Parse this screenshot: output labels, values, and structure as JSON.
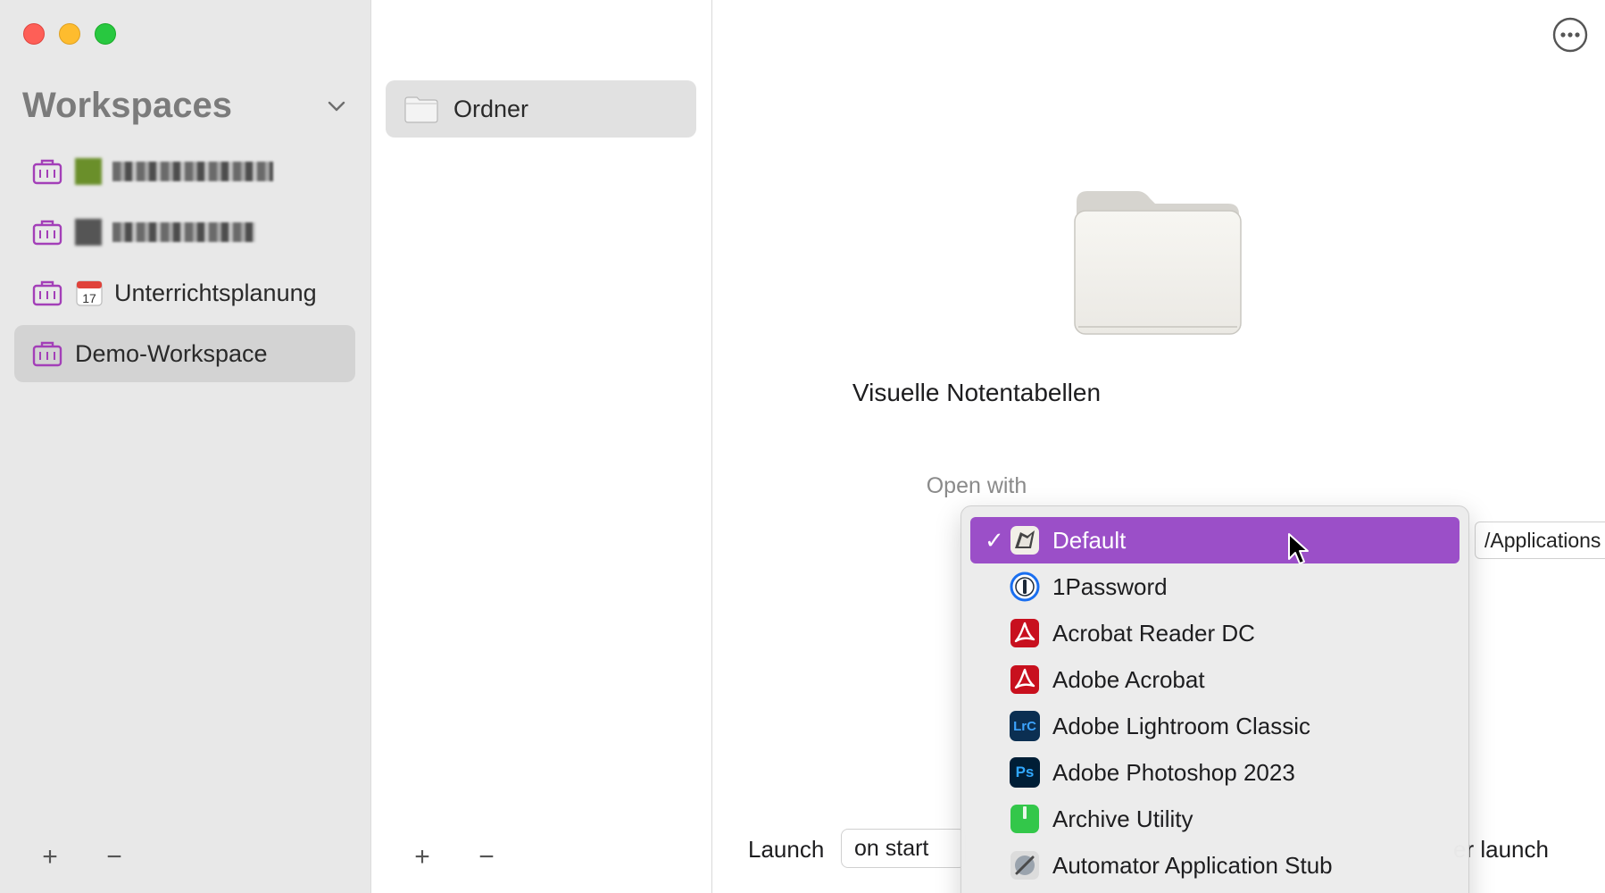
{
  "sidebar": {
    "header": "Workspaces",
    "items": [
      {
        "label": "",
        "blurred": true
      },
      {
        "label": "",
        "blurred": true
      },
      {
        "label": "Unterrichtsplanung",
        "blurred": false
      },
      {
        "label": "Demo-Workspace",
        "blurred": false,
        "selected": true
      }
    ],
    "add_label": "+",
    "remove_label": "−"
  },
  "middle": {
    "folder_label": "Ordner",
    "add_label": "+",
    "remove_label": "−"
  },
  "detail": {
    "title": "Visuelle Notentabellen",
    "open_with_label": "Open with",
    "path_value": "/Applications",
    "launch_label": "Launch",
    "launch_value": "on start",
    "after_launch_text": "er launch"
  },
  "menu": {
    "items": [
      {
        "label": "Default",
        "icon": "finder-icon",
        "selected": true
      },
      {
        "label": "1Password",
        "icon": "1password-icon"
      },
      {
        "label": "Acrobat Reader DC",
        "icon": "acrobat-reader-icon"
      },
      {
        "label": "Adobe Acrobat",
        "icon": "acrobat-icon"
      },
      {
        "label": "Adobe Lightroom Classic",
        "icon": "lightroom-icon",
        "icon_text": "LrC"
      },
      {
        "label": "Adobe Photoshop 2023",
        "icon": "photoshop-icon",
        "icon_text": "Ps"
      },
      {
        "label": "Archive Utility",
        "icon": "archive-utility-icon"
      },
      {
        "label": "Automator Application Stub",
        "icon": "automator-icon"
      }
    ]
  },
  "colors": {
    "accent": "#9b4fc8",
    "sidebar_bg": "#e8e8e8",
    "selection_bg": "#d3d3d3"
  }
}
